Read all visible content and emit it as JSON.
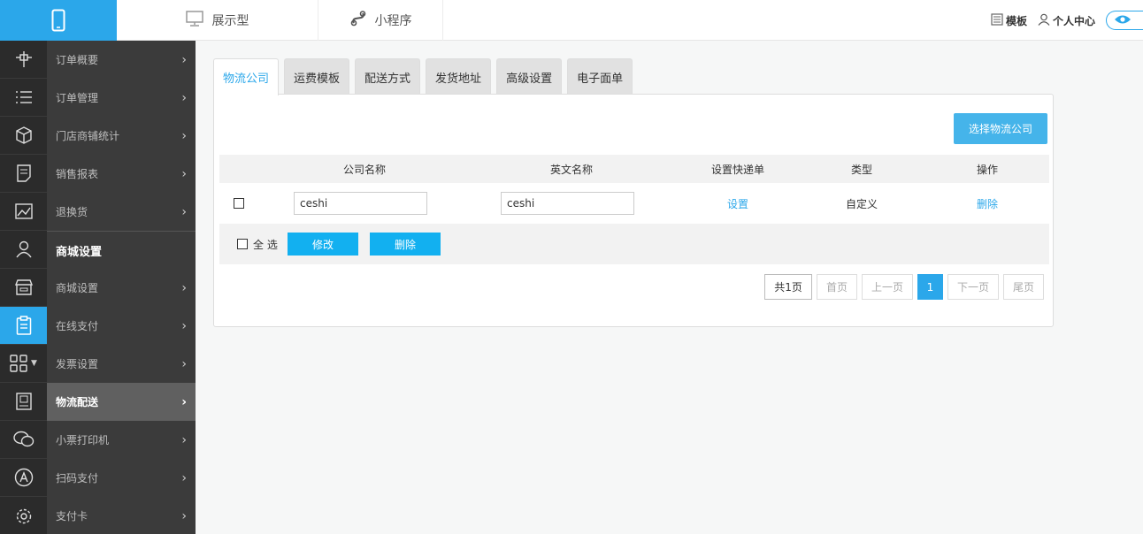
{
  "topbar": {
    "logo_icon": "mobile-phone-icon",
    "nav": [
      {
        "label": "展示型",
        "icon": "monitor-icon"
      },
      {
        "label": "小程序",
        "icon": "mini-program-icon"
      }
    ],
    "right": {
      "template_label": "模板",
      "user_center_label": "个人中心"
    }
  },
  "sidebar": {
    "icons": [
      "crosshair-icon",
      "list-icon",
      "cube-icon",
      "report-icon",
      "image-chart-icon",
      "user-icon",
      "store-icon",
      "clipboard-icon",
      "grid-icon",
      "book-icon",
      "wechat-icon",
      "appstore-icon",
      "gear-icon"
    ],
    "active_icon_index": 7,
    "items_top": [
      {
        "label": "订单概要"
      },
      {
        "label": "订单管理"
      },
      {
        "label": "门店商铺统计"
      },
      {
        "label": "销售报表"
      },
      {
        "label": "退换货"
      }
    ],
    "section_title": "商城设置",
    "items_bottom": [
      {
        "label": "商城设置"
      },
      {
        "label": "在线支付"
      },
      {
        "label": "发票设置"
      },
      {
        "label": "物流配送",
        "active": true
      },
      {
        "label": "小票打印机"
      },
      {
        "label": "扫码支付"
      },
      {
        "label": "支付卡"
      }
    ]
  },
  "tabs": [
    "物流公司",
    "运费模板",
    "配送方式",
    "发货地址",
    "高级设置",
    "电子面单"
  ],
  "panel": {
    "choose_button": "选择物流公司",
    "columns": [
      "公司名称",
      "英文名称",
      "设置快递单",
      "类型",
      "操作"
    ],
    "rows": [
      {
        "name": "ceshi",
        "en_name": "ceshi",
        "set_label": "设置",
        "type": "自定义",
        "delete_label": "删除"
      }
    ],
    "select_all_label": "全 选",
    "modify_button": "修改",
    "delete_button": "删除"
  },
  "pager": {
    "total": "共1页",
    "first": "首页",
    "prev": "上一页",
    "current": "1",
    "next": "下一页",
    "last": "尾页"
  },
  "colors": {
    "accent": "#2ba7ea",
    "sidebar_dark": "#2b2b2b",
    "sidebar_menu": "#3b3b3b"
  }
}
